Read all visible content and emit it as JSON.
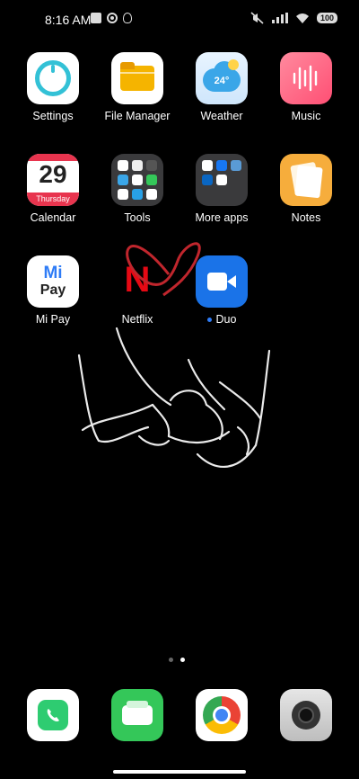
{
  "status_bar": {
    "time": "8:16 AM",
    "battery": "100"
  },
  "apps": [
    {
      "label": "Settings"
    },
    {
      "label": "File Manager"
    },
    {
      "label": "Weather",
      "badge_text": "24°"
    },
    {
      "label": "Music"
    },
    {
      "label": "Calendar",
      "day_number": "29",
      "weekday": "Thursday"
    },
    {
      "label": "Tools"
    },
    {
      "label": "More apps"
    },
    {
      "label": "Notes"
    },
    {
      "label": "Mi Pay",
      "logo_text_top": "Mi",
      "logo_text_bottom": "Pay"
    },
    {
      "label": "Netflix",
      "logo_letter": "N"
    },
    {
      "label": "Duo"
    }
  ],
  "dock": [
    {
      "name": "Phone"
    },
    {
      "name": "Messages"
    },
    {
      "name": "Chrome"
    },
    {
      "name": "Camera"
    }
  ],
  "page_indicator": {
    "count": 2,
    "active": 2
  },
  "colors": {
    "background": "#000000",
    "settings": "#33c1d6",
    "file_manager": "#f5b400",
    "weather": "#3aa6e8",
    "music": "#ff5f80",
    "calendar_red": "#e8344e",
    "notes": "#f6ad3c",
    "duo": "#1a73e8",
    "netflix_red": "#e50914",
    "phone": "#2ecc71",
    "messages": "#34c759"
  }
}
